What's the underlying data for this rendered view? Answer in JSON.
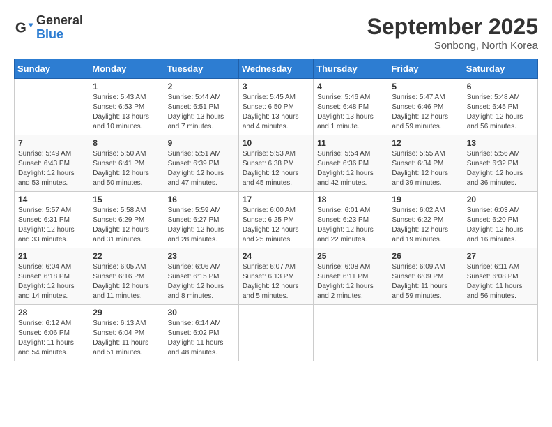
{
  "header": {
    "logo_general": "General",
    "logo_blue": "Blue",
    "month_year": "September 2025",
    "location": "Sonbong, North Korea"
  },
  "days_of_week": [
    "Sunday",
    "Monday",
    "Tuesday",
    "Wednesday",
    "Thursday",
    "Friday",
    "Saturday"
  ],
  "weeks": [
    [
      {
        "day": "",
        "info": ""
      },
      {
        "day": "1",
        "info": "Sunrise: 5:43 AM\nSunset: 6:53 PM\nDaylight: 13 hours\nand 10 minutes."
      },
      {
        "day": "2",
        "info": "Sunrise: 5:44 AM\nSunset: 6:51 PM\nDaylight: 13 hours\nand 7 minutes."
      },
      {
        "day": "3",
        "info": "Sunrise: 5:45 AM\nSunset: 6:50 PM\nDaylight: 13 hours\nand 4 minutes."
      },
      {
        "day": "4",
        "info": "Sunrise: 5:46 AM\nSunset: 6:48 PM\nDaylight: 13 hours\nand 1 minute."
      },
      {
        "day": "5",
        "info": "Sunrise: 5:47 AM\nSunset: 6:46 PM\nDaylight: 12 hours\nand 59 minutes."
      },
      {
        "day": "6",
        "info": "Sunrise: 5:48 AM\nSunset: 6:45 PM\nDaylight: 12 hours\nand 56 minutes."
      }
    ],
    [
      {
        "day": "7",
        "info": "Sunrise: 5:49 AM\nSunset: 6:43 PM\nDaylight: 12 hours\nand 53 minutes."
      },
      {
        "day": "8",
        "info": "Sunrise: 5:50 AM\nSunset: 6:41 PM\nDaylight: 12 hours\nand 50 minutes."
      },
      {
        "day": "9",
        "info": "Sunrise: 5:51 AM\nSunset: 6:39 PM\nDaylight: 12 hours\nand 47 minutes."
      },
      {
        "day": "10",
        "info": "Sunrise: 5:53 AM\nSunset: 6:38 PM\nDaylight: 12 hours\nand 45 minutes."
      },
      {
        "day": "11",
        "info": "Sunrise: 5:54 AM\nSunset: 6:36 PM\nDaylight: 12 hours\nand 42 minutes."
      },
      {
        "day": "12",
        "info": "Sunrise: 5:55 AM\nSunset: 6:34 PM\nDaylight: 12 hours\nand 39 minutes."
      },
      {
        "day": "13",
        "info": "Sunrise: 5:56 AM\nSunset: 6:32 PM\nDaylight: 12 hours\nand 36 minutes."
      }
    ],
    [
      {
        "day": "14",
        "info": "Sunrise: 5:57 AM\nSunset: 6:31 PM\nDaylight: 12 hours\nand 33 minutes."
      },
      {
        "day": "15",
        "info": "Sunrise: 5:58 AM\nSunset: 6:29 PM\nDaylight: 12 hours\nand 31 minutes."
      },
      {
        "day": "16",
        "info": "Sunrise: 5:59 AM\nSunset: 6:27 PM\nDaylight: 12 hours\nand 28 minutes."
      },
      {
        "day": "17",
        "info": "Sunrise: 6:00 AM\nSunset: 6:25 PM\nDaylight: 12 hours\nand 25 minutes."
      },
      {
        "day": "18",
        "info": "Sunrise: 6:01 AM\nSunset: 6:23 PM\nDaylight: 12 hours\nand 22 minutes."
      },
      {
        "day": "19",
        "info": "Sunrise: 6:02 AM\nSunset: 6:22 PM\nDaylight: 12 hours\nand 19 minutes."
      },
      {
        "day": "20",
        "info": "Sunrise: 6:03 AM\nSunset: 6:20 PM\nDaylight: 12 hours\nand 16 minutes."
      }
    ],
    [
      {
        "day": "21",
        "info": "Sunrise: 6:04 AM\nSunset: 6:18 PM\nDaylight: 12 hours\nand 14 minutes."
      },
      {
        "day": "22",
        "info": "Sunrise: 6:05 AM\nSunset: 6:16 PM\nDaylight: 12 hours\nand 11 minutes."
      },
      {
        "day": "23",
        "info": "Sunrise: 6:06 AM\nSunset: 6:15 PM\nDaylight: 12 hours\nand 8 minutes."
      },
      {
        "day": "24",
        "info": "Sunrise: 6:07 AM\nSunset: 6:13 PM\nDaylight: 12 hours\nand 5 minutes."
      },
      {
        "day": "25",
        "info": "Sunrise: 6:08 AM\nSunset: 6:11 PM\nDaylight: 12 hours\nand 2 minutes."
      },
      {
        "day": "26",
        "info": "Sunrise: 6:09 AM\nSunset: 6:09 PM\nDaylight: 11 hours\nand 59 minutes."
      },
      {
        "day": "27",
        "info": "Sunrise: 6:11 AM\nSunset: 6:08 PM\nDaylight: 11 hours\nand 56 minutes."
      }
    ],
    [
      {
        "day": "28",
        "info": "Sunrise: 6:12 AM\nSunset: 6:06 PM\nDaylight: 11 hours\nand 54 minutes."
      },
      {
        "day": "29",
        "info": "Sunrise: 6:13 AM\nSunset: 6:04 PM\nDaylight: 11 hours\nand 51 minutes."
      },
      {
        "day": "30",
        "info": "Sunrise: 6:14 AM\nSunset: 6:02 PM\nDaylight: 11 hours\nand 48 minutes."
      },
      {
        "day": "",
        "info": ""
      },
      {
        "day": "",
        "info": ""
      },
      {
        "day": "",
        "info": ""
      },
      {
        "day": "",
        "info": ""
      }
    ]
  ]
}
